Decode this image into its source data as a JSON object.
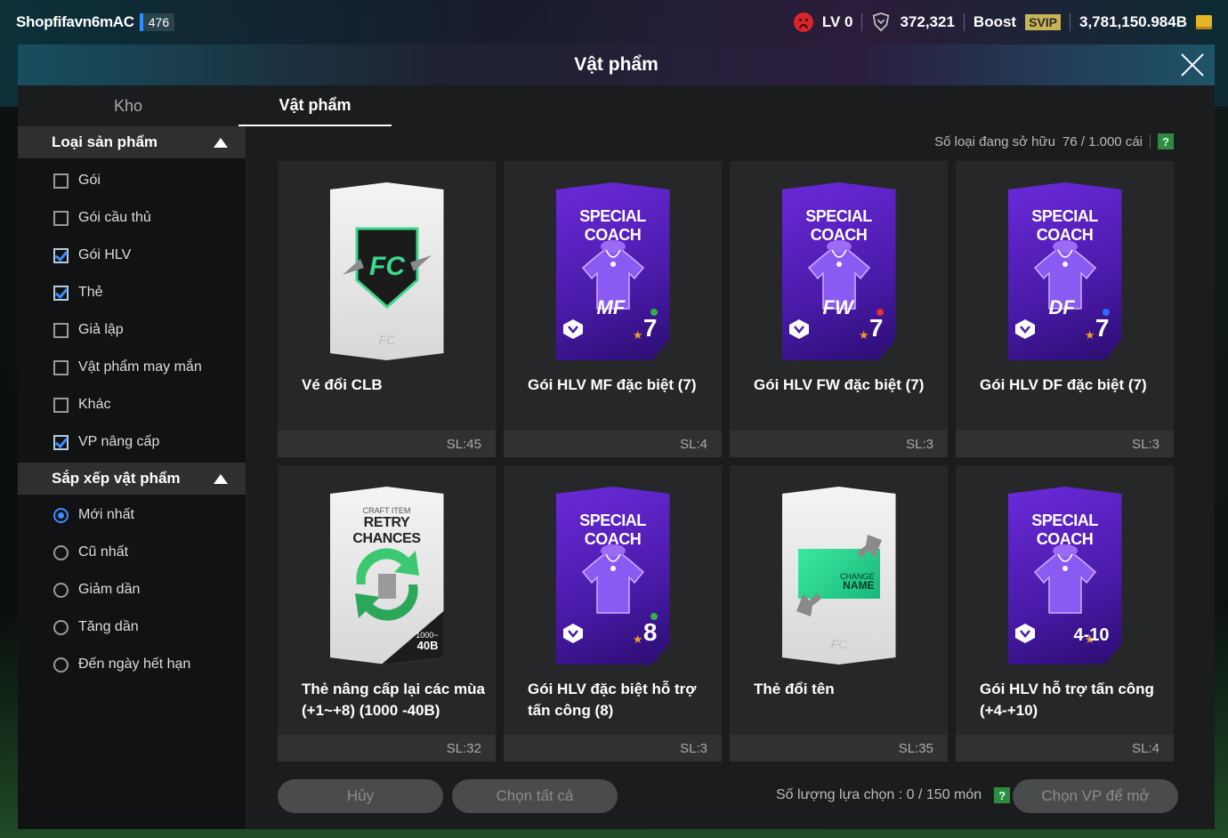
{
  "topbar": {
    "username": "Shopfifavn6mAC",
    "user_level": "476",
    "lv": "LV 0",
    "shield_value": "372,321",
    "boost_label": "Boost",
    "svip_label": "SVIP",
    "coins": "3,781,150.984B"
  },
  "modal": {
    "title": "Vật phẩm",
    "tabs": [
      {
        "label": "Kho",
        "active": false
      },
      {
        "label": "Vật phẩm",
        "active": true
      }
    ]
  },
  "sidebar": {
    "filter_title": "Loại sản phẩm",
    "filters": [
      {
        "label": "Gói",
        "checked": false
      },
      {
        "label": "Gói cầu thủ",
        "checked": false
      },
      {
        "label": "Gói HLV",
        "checked": true
      },
      {
        "label": "Thẻ",
        "checked": true
      },
      {
        "label": "Giả lập",
        "checked": false
      },
      {
        "label": "Vật phẩm may mắn",
        "checked": false
      },
      {
        "label": "Khác",
        "checked": false
      },
      {
        "label": "VP nâng cấp",
        "checked": true
      }
    ],
    "sort_title": "Sắp xếp vật phẩm",
    "sorts": [
      {
        "label": "Mới nhất",
        "selected": true
      },
      {
        "label": "Cũ nhất",
        "selected": false
      },
      {
        "label": "Giảm dần",
        "selected": false
      },
      {
        "label": "Tăng dần",
        "selected": false
      },
      {
        "label": "Đến ngày hết hạn",
        "selected": false
      }
    ]
  },
  "owned": {
    "label": "Số loại đang sở hữu",
    "value": "76 / 1.000 cái"
  },
  "items": [
    {
      "name": "Vé đổi CLB",
      "qty": "SL:45",
      "art": "club-ticket"
    },
    {
      "name": "Gói HLV MF đặc biệt (7)",
      "qty": "SL:4",
      "art": "coach",
      "pos": "MF",
      "level": "7",
      "dot": "#2fb24a",
      "title": "SPECIAL COACH"
    },
    {
      "name": "Gói HLV FW đặc biệt (7)",
      "qty": "SL:3",
      "art": "coach",
      "pos": "FW",
      "level": "7",
      "dot": "#e0303a",
      "title": "SPECIAL COACH"
    },
    {
      "name": "Gói HLV DF đặc biệt (7)",
      "qty": "SL:3",
      "art": "coach",
      "pos": "DF",
      "level": "7",
      "dot": "#2d6cff",
      "title": "SPECIAL COACH"
    },
    {
      "name": "Thẻ nâng cấp lại các mùa (+1~+8) (1000 -40B)",
      "qty": "SL:32",
      "art": "retry",
      "craft_small": "CRAFT ITEM",
      "craft_big": "RETRY CHANCES",
      "range_top": "1000~",
      "range_bottom": "40B"
    },
    {
      "name": "Gói HLV đặc biệt hỗ trợ tấn công (8)",
      "qty": "SL:3",
      "art": "coach",
      "pos": "",
      "level": "8",
      "dot": "#2fb24a",
      "title": "SPECIAL COACH"
    },
    {
      "name": "Thẻ đổi tên",
      "qty": "SL:35",
      "art": "change-name",
      "change_small": "CHANGE",
      "change_big": "NAME"
    },
    {
      "name": "Gói HLV hỗ trợ tấn công (+4-+10)",
      "qty": "SL:4",
      "art": "coach",
      "pos": "",
      "level": "4-10",
      "dot": "",
      "title": "SPECIAL COACH"
    }
  ],
  "footer": {
    "cancel_label": "Hủy",
    "select_all_label": "Chọn tất cả",
    "select_count": "Số lượng lựa chọn : 0 / 150 món",
    "open_label": "Chọn VP để mở",
    "help_label": "?"
  }
}
